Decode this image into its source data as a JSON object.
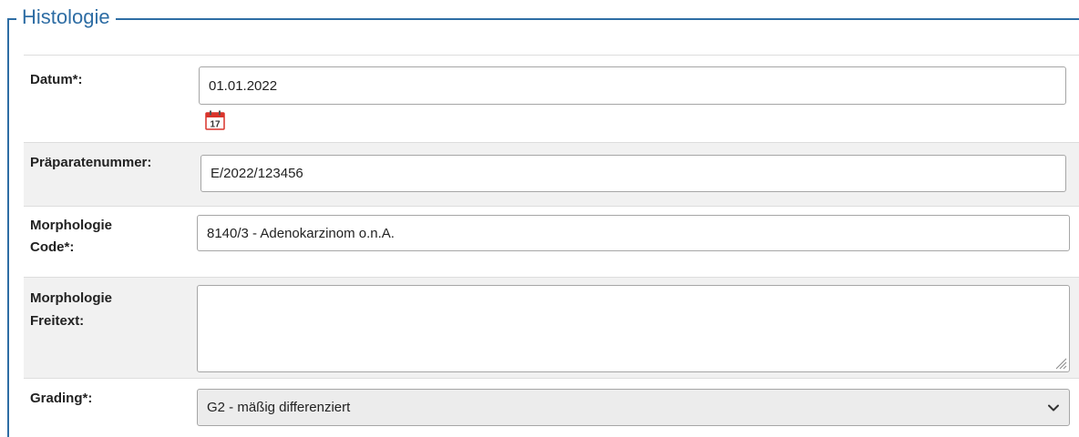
{
  "section": {
    "legend": "Histologie"
  },
  "fields": {
    "datum": {
      "label": "Datum*:",
      "value": "01.01.2022"
    },
    "calendar": {
      "day": "17",
      "icon": "calendar-icon"
    },
    "praeparat": {
      "label": "Präparatenummer:",
      "value": "E/2022/123456"
    },
    "morph_code": {
      "label_line1": "Morphologie",
      "label_line2": "Code*:",
      "value": "8140/3 - Adenokarzinom o.n.A."
    },
    "morph_freitext": {
      "label_line1": "Morphologie",
      "label_line2": "Freitext:",
      "value": ""
    },
    "grading": {
      "label": "Grading*:",
      "selected": "G2 - mäßig differenziert"
    }
  },
  "colors": {
    "accent": "#2e6da4",
    "calendar_red": "#d9342b"
  }
}
